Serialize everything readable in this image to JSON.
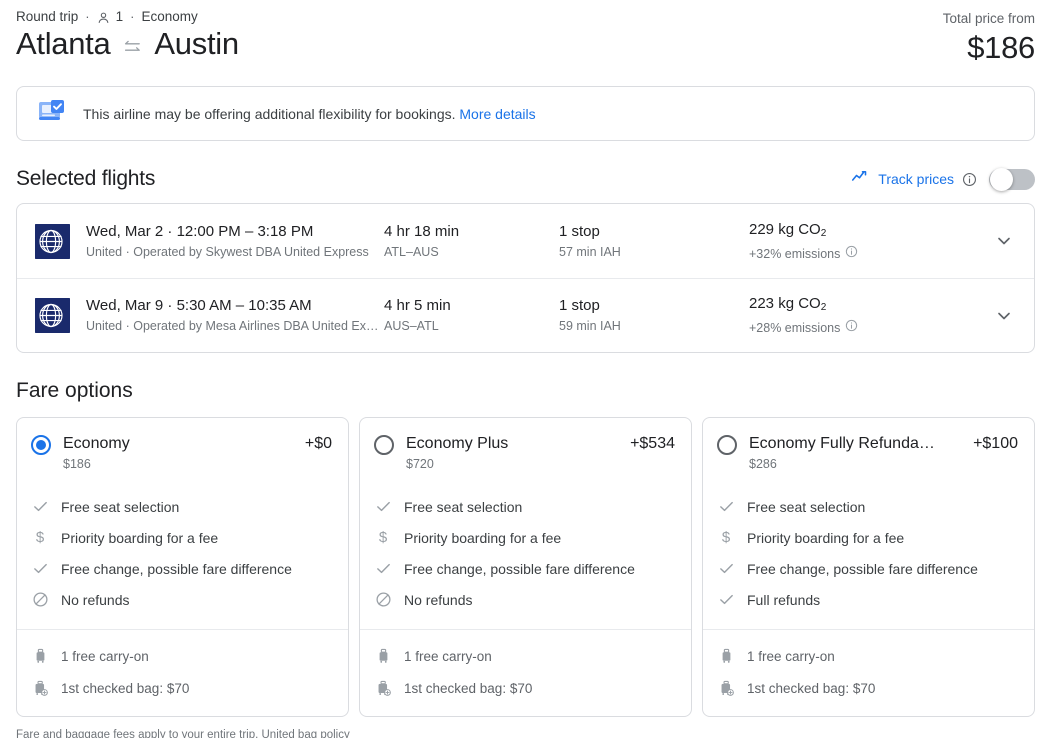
{
  "header": {
    "trip_type": "Round trip",
    "passengers": "1",
    "cabin": "Economy",
    "separator": "·",
    "origin": "Atlanta",
    "destination": "Austin",
    "total_price_label": "Total price from",
    "total_price": "$186"
  },
  "notice": {
    "text": "This airline may be offering additional flexibility for bookings.",
    "link": "More details"
  },
  "selected_flights": {
    "title": "Selected flights",
    "track_prices_label": "Track prices",
    "toggle_state": "off",
    "rows": [
      {
        "datetime": "Wed, Mar 2  ·  12:00 PM – 3:18 PM",
        "airline": "United · Operated by Skywest DBA United Express",
        "duration": "4 hr 18 min",
        "route": "ATL–AUS",
        "stops": "1 stop",
        "layover": "57 min IAH",
        "co2": "229 kg CO",
        "co2_sub": "2",
        "emissions": "+32% emissions"
      },
      {
        "datetime": "Wed, Mar 9  ·  5:30 AM – 10:35 AM",
        "airline": "United · Operated by Mesa Airlines DBA United Ex…",
        "duration": "4 hr 5 min",
        "route": "AUS–ATL",
        "stops": "1 stop",
        "layover": "59 min IAH",
        "co2": "223 kg CO",
        "co2_sub": "2",
        "emissions": "+28% emissions"
      }
    ]
  },
  "fare_options": {
    "title": "Fare options",
    "cards": [
      {
        "name": "Economy",
        "price": "$186",
        "delta": "+$0",
        "selected": true,
        "features": [
          {
            "icon": "check-icon",
            "text": "Free seat selection"
          },
          {
            "icon": "dollar-icon",
            "text": "Priority boarding for a fee"
          },
          {
            "icon": "check-icon",
            "text": "Free change, possible fare difference"
          },
          {
            "icon": "no-refund-icon",
            "text": "No refunds"
          }
        ],
        "baggage": [
          {
            "icon": "carry-on-icon",
            "text": "1 free carry-on"
          },
          {
            "icon": "checked-bag-icon",
            "text": "1st checked bag: $70"
          }
        ]
      },
      {
        "name": "Economy Plus",
        "price": "$720",
        "delta": "+$534",
        "selected": false,
        "features": [
          {
            "icon": "check-icon",
            "text": "Free seat selection"
          },
          {
            "icon": "dollar-icon",
            "text": "Priority boarding for a fee"
          },
          {
            "icon": "check-icon",
            "text": "Free change, possible fare difference"
          },
          {
            "icon": "no-refund-icon",
            "text": "No refunds"
          }
        ],
        "baggage": [
          {
            "icon": "carry-on-icon",
            "text": "1 free carry-on"
          },
          {
            "icon": "checked-bag-icon",
            "text": "1st checked bag: $70"
          }
        ]
      },
      {
        "name": "Economy Fully Refunda…",
        "price": "$286",
        "delta": "+$100",
        "selected": false,
        "features": [
          {
            "icon": "check-icon",
            "text": "Free seat selection"
          },
          {
            "icon": "dollar-icon",
            "text": "Priority boarding for a fee"
          },
          {
            "icon": "check-icon",
            "text": "Free change, possible fare difference"
          },
          {
            "icon": "check-icon",
            "text": "Full refunds"
          }
        ],
        "baggage": [
          {
            "icon": "carry-on-icon",
            "text": "1 free carry-on"
          },
          {
            "icon": "checked-bag-icon",
            "text": "1st checked bag: $70"
          }
        ]
      }
    ]
  },
  "footer": {
    "text": "Fare and baggage fees apply to your entire trip.",
    "link": "United bag policy"
  },
  "colors": {
    "accent_blue": "#1a73e8",
    "united_navy": "#1a2a6c",
    "text_primary": "#202124",
    "text_secondary": "#70757a",
    "border": "#dadce0"
  }
}
